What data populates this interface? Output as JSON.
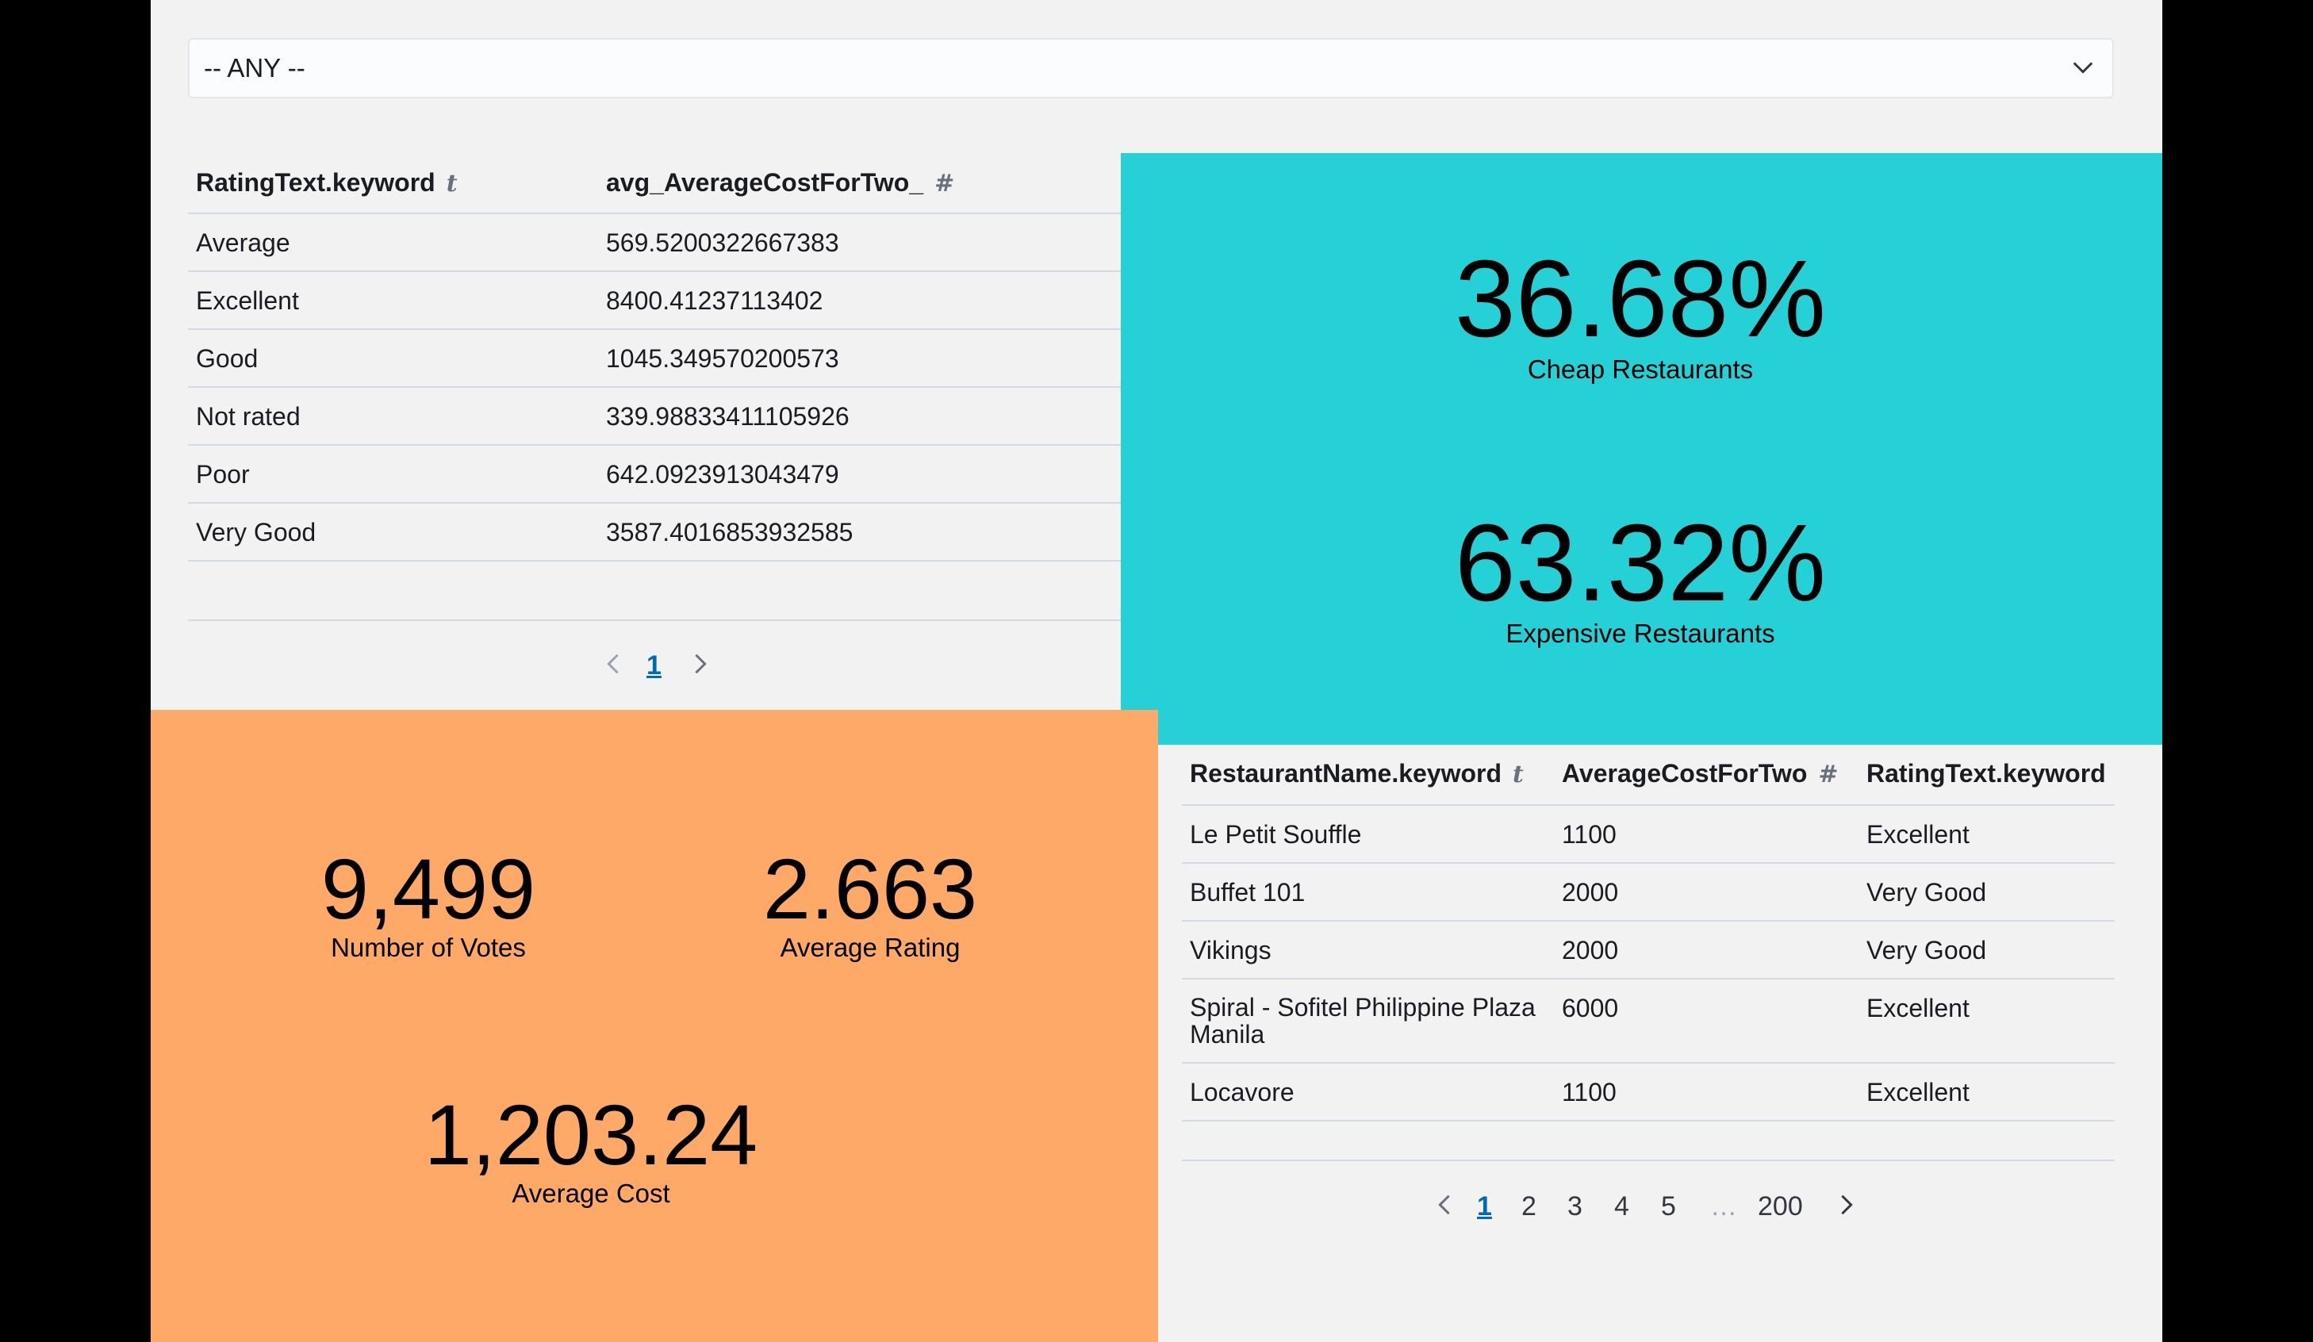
{
  "filter": {
    "selected": "-- ANY --"
  },
  "rating_table": {
    "headers": [
      "RatingText.keyword",
      "avg_AverageCostForTwo_"
    ],
    "header_types": [
      "t",
      "#"
    ],
    "rows": [
      [
        "Average",
        "569.5200322667383"
      ],
      [
        "Excellent",
        "8400.41237113402"
      ],
      [
        "Good",
        "1045.349570200573"
      ],
      [
        "Not rated",
        "339.98833411105926"
      ],
      [
        "Poor",
        "642.0923913043479"
      ],
      [
        "Very Good",
        "3587.4016853932585"
      ]
    ],
    "pagination": {
      "current": "1"
    }
  },
  "cheap_metric": {
    "value": "36.68%",
    "label": "Cheap Restaurants"
  },
  "expensive_metric": {
    "value": "63.32%",
    "label": "Expensive Restaurants"
  },
  "votes_metric": {
    "value": "9,499",
    "label": "Number of Votes"
  },
  "rating_metric": {
    "value": "2.663",
    "label": "Average Rating"
  },
  "cost_metric": {
    "value": "1,203.24",
    "label": "Average Cost"
  },
  "restaurant_table": {
    "headers": [
      "RestaurantName.keyword",
      "AverageCostForTwo",
      "RatingText.keyword"
    ],
    "header_types": [
      "t",
      "#",
      ""
    ],
    "rows": [
      [
        "Le Petit Souffle",
        "1100",
        "Excellent"
      ],
      [
        "Buffet 101",
        "2000",
        "Very Good"
      ],
      [
        "Vikings",
        "2000",
        "Very Good"
      ],
      [
        "Spiral - Sofitel Philippine Plaza Manila",
        "6000",
        "Excellent"
      ],
      [
        "Locavore",
        "1100",
        "Excellent"
      ]
    ],
    "row0_line2": "Manila",
    "row3_line1": "Spiral - Sofitel Philippine Plaza",
    "pagination": {
      "pages": [
        "1",
        "2",
        "3",
        "4",
        "5"
      ],
      "ellipsis": "…",
      "last": "200",
      "current": "1"
    }
  }
}
